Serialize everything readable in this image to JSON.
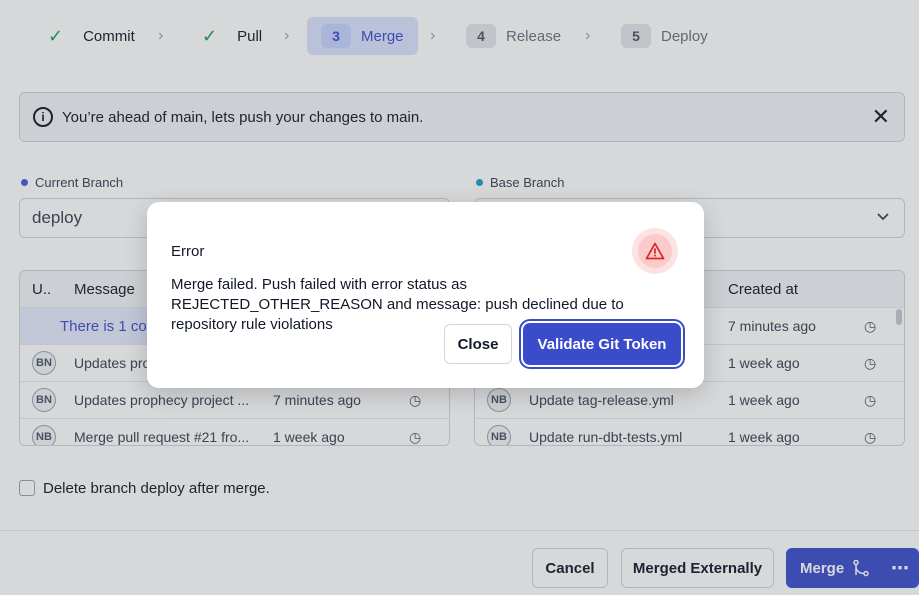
{
  "stepper": {
    "steps": [
      {
        "num": "",
        "label": "Commit",
        "state": "done"
      },
      {
        "num": "",
        "label": "Pull",
        "state": "done"
      },
      {
        "num": "3",
        "label": "Merge",
        "state": "active"
      },
      {
        "num": "4",
        "label": "Release",
        "state": "pending"
      },
      {
        "num": "5",
        "label": "Deploy",
        "state": "pending"
      }
    ]
  },
  "banner": {
    "text": "You’re ahead of main, lets push your changes to main."
  },
  "current_branch": {
    "label": "Current Branch",
    "value": "deploy",
    "dot_color": "#3b5bdb"
  },
  "base_branch": {
    "label": "Base Branch",
    "value": "",
    "dot_color": "#1c9ad6"
  },
  "left_table": {
    "headers": [
      "U..",
      "Message"
    ],
    "notice": "There is 1 co",
    "rows": [
      {
        "avatar": "BN",
        "message": "Updates prop",
        "created": ""
      },
      {
        "avatar": "BN",
        "message": "Updates prophecy project ...",
        "created": "7 minutes ago"
      },
      {
        "avatar": "NB",
        "message": "Merge pull request #21 fro...",
        "created": "1 week ago"
      }
    ]
  },
  "right_table": {
    "headers": [
      "Created at"
    ],
    "rows": [
      {
        "avatar": "",
        "message": "",
        "created": "7 minutes ago"
      },
      {
        "avatar": "",
        "message": "",
        "created": "1 week ago"
      },
      {
        "avatar": "NB",
        "message": "Update tag-release.yml",
        "created": "1 week ago"
      },
      {
        "avatar": "NB",
        "message": "Update run-dbt-tests.yml",
        "created": "1 week ago"
      }
    ]
  },
  "delete_branch": {
    "label": "Delete branch deploy after merge.",
    "checked": false
  },
  "footer": {
    "cancel": "Cancel",
    "merged_externally": "Merged Externally",
    "merge": "Merge",
    "more": "⋯"
  },
  "modal": {
    "title": "Error",
    "message": "Merge failed. Push failed with error status as REJECTED_OTHER_REASON and message: push declined due to repository rule violations",
    "close_label": "Close",
    "validate_label": "Validate Git Token",
    "warn_color": "#dc2626"
  }
}
